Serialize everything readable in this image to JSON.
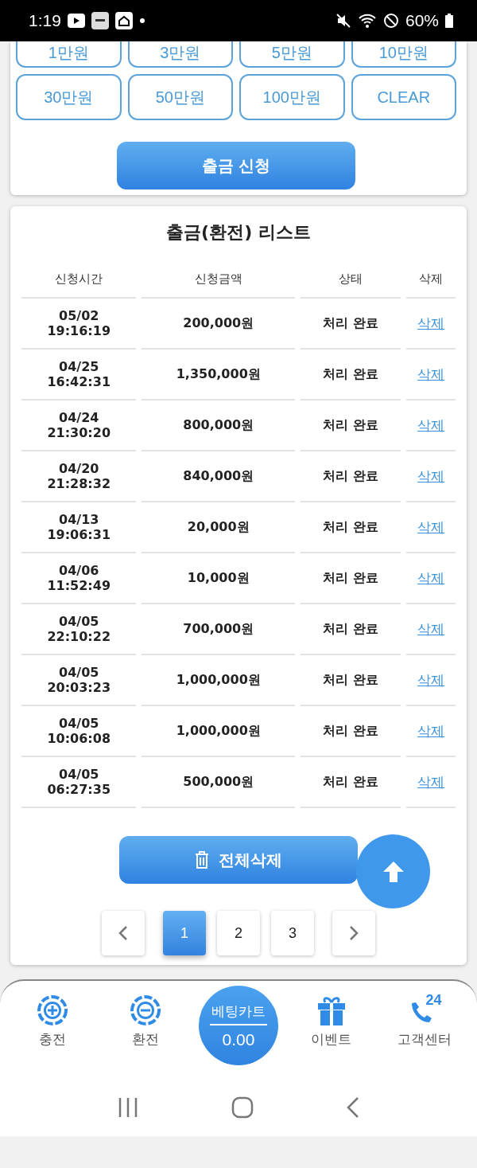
{
  "status_bar": {
    "time": "1:19",
    "battery": "60%"
  },
  "amount_buttons": [
    {
      "label": "1만원",
      "cut": true
    },
    {
      "label": "3만원",
      "cut": true
    },
    {
      "label": "5만원",
      "cut": true
    },
    {
      "label": "10만원",
      "cut": true
    },
    {
      "label": "30만원",
      "cut": false
    },
    {
      "label": "50만원",
      "cut": false
    },
    {
      "label": "100만원",
      "cut": false
    },
    {
      "label": "CLEAR",
      "cut": false
    }
  ],
  "submit_button": "출금 신청",
  "list": {
    "title": "출금(환전) 리스트",
    "columns": [
      "신청시간",
      "신청금액",
      "상태",
      "삭제"
    ],
    "rows": [
      {
        "date": "05/02",
        "time": "19:16:19",
        "amount": "200,000원",
        "status": "처리 완료",
        "action": "삭제"
      },
      {
        "date": "04/25",
        "time": "16:42:31",
        "amount": "1,350,000원",
        "status": "처리 완료",
        "action": "삭제"
      },
      {
        "date": "04/24",
        "time": "21:30:20",
        "amount": "800,000원",
        "status": "처리 완료",
        "action": "삭제"
      },
      {
        "date": "04/20",
        "time": "21:28:32",
        "amount": "840,000원",
        "status": "처리 완료",
        "action": "삭제"
      },
      {
        "date": "04/13",
        "time": "19:06:31",
        "amount": "20,000원",
        "status": "처리 완료",
        "action": "삭제"
      },
      {
        "date": "04/06",
        "time": "11:52:49",
        "amount": "10,000원",
        "status": "처리 완료",
        "action": "삭제"
      },
      {
        "date": "04/05",
        "time": "22:10:22",
        "amount": "700,000원",
        "status": "처리 완료",
        "action": "삭제"
      },
      {
        "date": "04/05",
        "time": "20:03:23",
        "amount": "1,000,000원",
        "status": "처리 완료",
        "action": "삭제"
      },
      {
        "date": "04/05",
        "time": "10:06:08",
        "amount": "1,000,000원",
        "status": "처리 완료",
        "action": "삭제"
      },
      {
        "date": "04/05",
        "time": "06:27:35",
        "amount": "500,000원",
        "status": "처리 완료",
        "action": "삭제"
      }
    ],
    "delete_all": "전체삭제",
    "pages": [
      {
        "label": "1",
        "selected": true
      },
      {
        "label": "2",
        "selected": false
      },
      {
        "label": "3",
        "selected": false
      }
    ]
  },
  "bottom_nav": [
    {
      "kind": "charge",
      "label": "충전"
    },
    {
      "kind": "exchange",
      "label": "환전"
    },
    {
      "kind": "cart",
      "label": "베팅카트",
      "value": "0.00"
    },
    {
      "kind": "event",
      "label": "이벤트"
    },
    {
      "kind": "support",
      "label": "고객센터",
      "badge": "24"
    }
  ]
}
